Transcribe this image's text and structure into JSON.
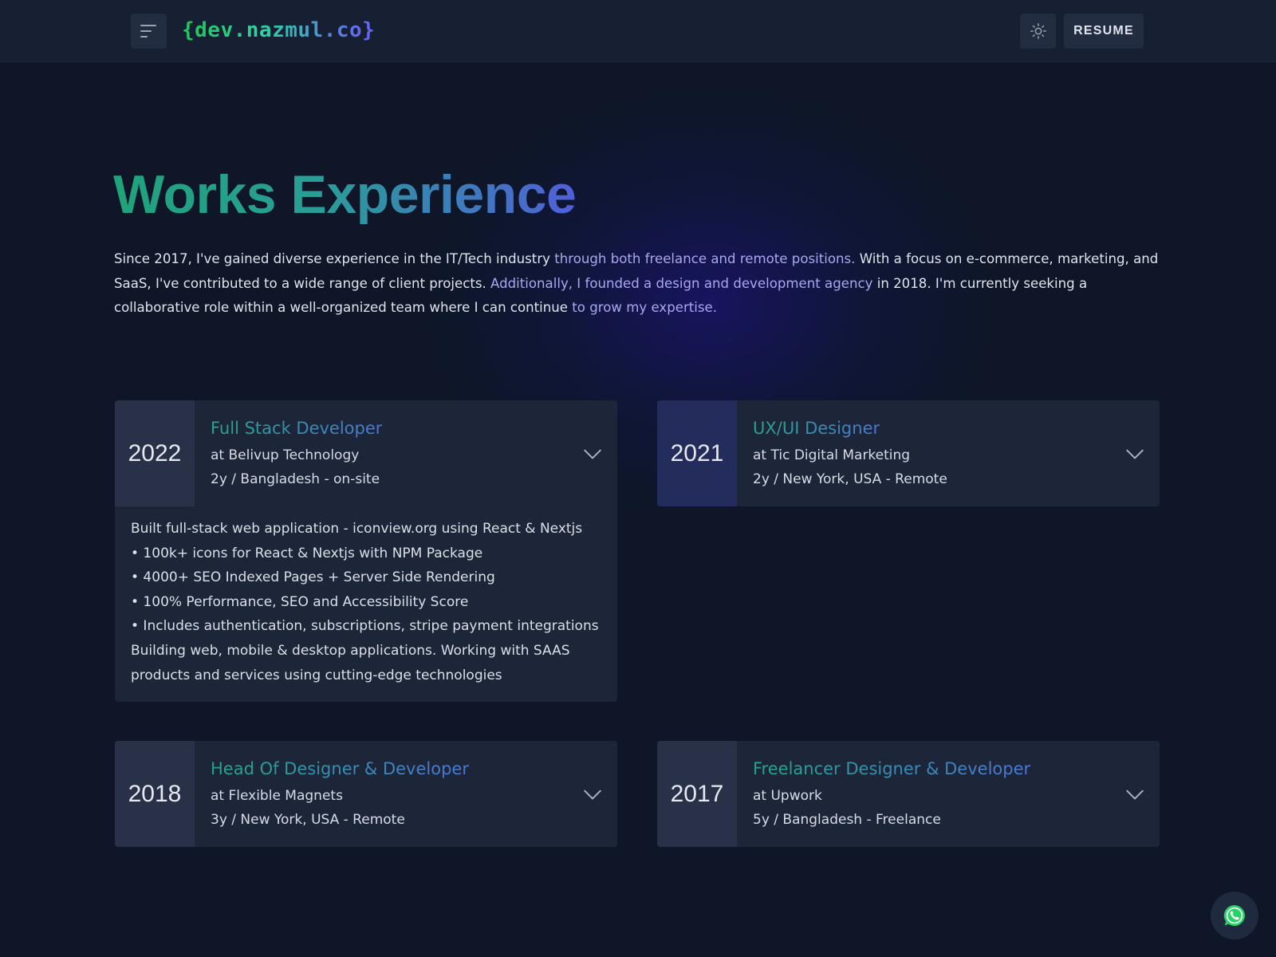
{
  "header": {
    "logo_open": "{",
    "logo_text": "dev.nazmul.co",
    "logo_close": "}",
    "resume_label": "RESUME",
    "icons": {
      "menu": "menu-lines-icon",
      "theme": "sun-icon"
    }
  },
  "page": {
    "title": "Works Experience",
    "intro": [
      {
        "text": "Since 2017, I've gained diverse experience in the IT/Tech industry ",
        "highlight": false
      },
      {
        "text": "through both freelance and remote positions.",
        "highlight": true
      },
      {
        "text": " With a focus on e-commerce, marketing, and SaaS, I've contributed to a wide range of client projects. ",
        "highlight": false
      },
      {
        "text": "Additionally, I founded a design and development agency",
        "highlight": true
      },
      {
        "text": " in 2018. I'm currently seeking a collaborative role within a well-organized team where I can continue ",
        "highlight": false
      },
      {
        "text": "to grow my expertise.",
        "highlight": true
      }
    ]
  },
  "experiences": [
    {
      "year": "2022",
      "title": "Full Stack Developer",
      "company": "at Belivup Technology",
      "meta": "2y / Bangladesh - on-site",
      "expanded": true,
      "description": [
        "Built full-stack web application - iconview.org using React & Nextjs",
        "• 100k+ icons for React & Nextjs with NPM Package",
        "• 4000+ SEO Indexed Pages + Server Side Rendering",
        "• 100% Performance, SEO and Accessibility Score",
        "• Includes authentication, subscriptions, stripe payment integrations",
        "Building web, mobile & desktop applications. Working with SAAS",
        "products and services using cutting-edge technologies"
      ]
    },
    {
      "year": "2021",
      "title": "UX/UI Designer",
      "company": "at Tic Digital Marketing",
      "meta": "2y / New York, USA - Remote",
      "expanded": false
    },
    {
      "year": "2018",
      "title": "Head Of Designer & Developer",
      "company": "at Flexible Magnets",
      "meta": "3y / New York, USA - Remote",
      "expanded": false
    },
    {
      "year": "2017",
      "title": "Freelancer Designer & Developer",
      "company": "at Upwork",
      "meta": "5y / Bangladesh - Freelance",
      "expanded": false
    }
  ],
  "floating": {
    "icon": "whatsapp-icon"
  },
  "colors": {
    "background": "#0e1628",
    "header": "#172033",
    "card": "#1d2638",
    "year_panel": "#283147",
    "accent_green": "#22c55e",
    "accent_indigo": "#6366f1",
    "whatsapp": "#25d366"
  }
}
